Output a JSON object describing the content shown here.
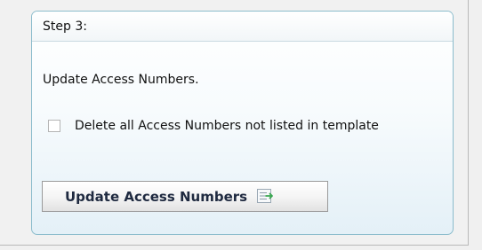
{
  "panel": {
    "title": "Step 3:",
    "description": "Update Access Numbers.",
    "checkbox_label": "Delete all Access Numbers not listed in template",
    "checkbox_checked": false,
    "button_label": "Update Access Numbers",
    "button_icon": "list-add-icon"
  },
  "colors": {
    "panel_border": "#8bbccc",
    "button_text": "#1f2a40",
    "icon_accent": "#3aa651"
  }
}
